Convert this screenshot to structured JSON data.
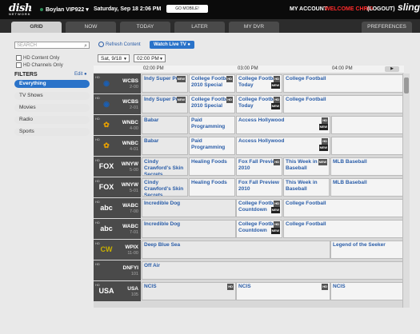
{
  "topbar": {
    "logo": "dish",
    "logo_sub": "NETWORK",
    "receiver": "Boylan VIP922",
    "datetime": "Saturday, Sep 18  2:06 PM",
    "mobile_btn": "GO MOBILE!",
    "account": "MY ACCOUNT",
    "welcome": "WELCOME CHRIS",
    "logout": "(LOGOUT)",
    "brand": "sling"
  },
  "tabs": [
    "GRID",
    "NOW",
    "TODAY",
    "LATER",
    "MY DVR",
    "PREFERENCES"
  ],
  "sidebar": {
    "search_placeholder": "SEARCH",
    "hd_content_only": "HD Content Only",
    "hd_channels_only": "HD Channels Only",
    "filters_title": "FILTERS",
    "edit": "Edit",
    "filters": [
      "Everything",
      "TV Shows",
      "Movies",
      "Radio",
      "Sports"
    ]
  },
  "controls": {
    "refresh": "Refresh Content",
    "watch_live": "Watch Live TV",
    "date": "Sat, 9/18",
    "time": "02:00 PM"
  },
  "timeline": [
    "02:00 PM",
    "03:00 PM",
    "04:00 PM"
  ],
  "rows": [
    {
      "call": "WCBS",
      "num": "2-00",
      "icon": "CBS",
      "progs": [
        {
          "t": "Indy Super Pull",
          "badge": "NEW"
        },
        {
          "t": "College Football 2010 Special",
          "badge": "HD"
        },
        {
          "t": "College Football Today",
          "badge": "HD",
          "badge2": "NEW"
        },
        {
          "t": "College Football"
        }
      ]
    },
    {
      "call": "WCBS",
      "num": "2-01",
      "icon": "CBS",
      "progs": [
        {
          "t": "Indy Super Pull",
          "badge": "NEW"
        },
        {
          "t": "College Football 2010 Special",
          "badge": "HD"
        },
        {
          "t": "College Football Today",
          "badge": "HD",
          "badge2": "NEW"
        },
        {
          "t": "College Football"
        }
      ]
    },
    {
      "call": "WNBC",
      "num": "4-00",
      "icon": "NBC",
      "progs": [
        {
          "t": "Babar"
        },
        {
          "t": "Paid Programming"
        },
        {
          "t": "Access Hollywood",
          "badge": "HD",
          "badge2": "NEW"
        },
        {
          "t": ""
        }
      ]
    },
    {
      "call": "WNBC",
      "num": "4-01",
      "icon": "NBC",
      "progs": [
        {
          "t": "Babar"
        },
        {
          "t": "Paid Programming"
        },
        {
          "t": "Access Hollywood",
          "badge": "HD",
          "badge2": "NEW"
        },
        {
          "t": ""
        }
      ]
    },
    {
      "call": "WNYW",
      "num": "5-00",
      "icon": "FOX",
      "progs": [
        {
          "t": "Cindy Crawford's Skin Secrets"
        },
        {
          "t": "Healing Foods"
        },
        {
          "t": "Fox Fall Preview 2010",
          "badge": "HD"
        },
        {
          "t": "This Week in Baseball",
          "badge": "NEW"
        },
        {
          "t": "MLB Baseball"
        }
      ]
    },
    {
      "call": "WNYW",
      "num": "5-01",
      "icon": "FOX",
      "progs": [
        {
          "t": "Cindy Crawford's Skin Secrets"
        },
        {
          "t": "Healing Foods"
        },
        {
          "t": "Fox Fall Preview 2010"
        },
        {
          "t": "This Week in Baseball"
        },
        {
          "t": "MLB Baseball"
        }
      ]
    },
    {
      "call": "WABC",
      "num": "7-00",
      "icon": "abc",
      "progs": [
        {
          "t": "Incredible Dog"
        },
        {
          "t": "College Football Countdown",
          "badge": "HD",
          "badge2": "NEW"
        },
        {
          "t": "College Football"
        }
      ]
    },
    {
      "call": "WABC",
      "num": "7-01",
      "icon": "abc",
      "progs": [
        {
          "t": "Incredible Dog"
        },
        {
          "t": "College Football Countdown",
          "badge": "HD",
          "badge2": "NEW"
        },
        {
          "t": "College Football"
        }
      ]
    },
    {
      "call": "WPIX",
      "num": "11-00",
      "icon": "CW",
      "progs": [
        {
          "t": "Deep Blue Sea"
        },
        {
          "t": "Legend of the Seeker"
        }
      ]
    },
    {
      "call": "DNFYI",
      "num": "101",
      "icon": "",
      "progs": [
        {
          "t": "Off Air"
        }
      ]
    },
    {
      "call": "USA",
      "num": "105",
      "icon": "USA",
      "progs": [
        {
          "t": "NCIS",
          "badge": "HD"
        },
        {
          "t": "NCIS",
          "badge": "HD"
        },
        {
          "t": "NCIS"
        }
      ]
    }
  ]
}
